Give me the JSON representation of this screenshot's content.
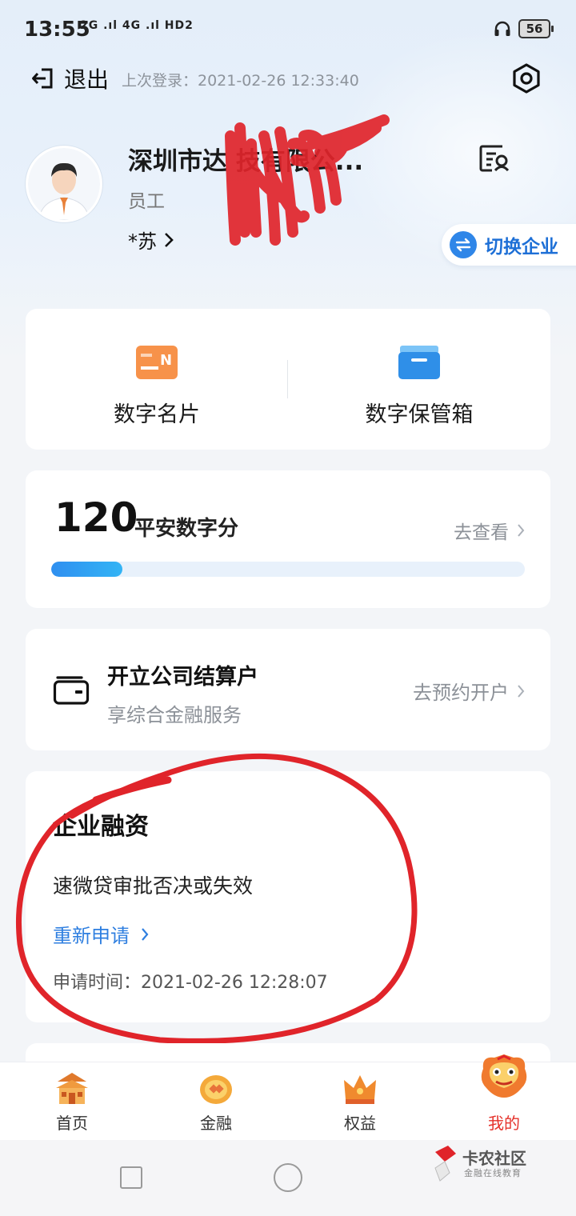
{
  "status_bar": {
    "time": "13:55",
    "network": "2G .ıl 4G .ıl HD2",
    "battery": "56"
  },
  "header": {
    "logout_label": "退出",
    "last_login": "上次登录：2021-02-26 12:33:40"
  },
  "profile": {
    "company": "深圳市达      技有限公...",
    "role": "员工",
    "user_name": "*苏",
    "switch_label": "切换企业"
  },
  "quick_actions": [
    {
      "label": "数字名片",
      "icon": "business-card-icon"
    },
    {
      "label": "数字保管箱",
      "icon": "safe-box-icon"
    }
  ],
  "score": {
    "value": "120",
    "label": "平安数字分",
    "link": "去查看",
    "progress": 0.15
  },
  "account": {
    "title": "开立公司结算户",
    "subtitle": "享综合金融服务",
    "link": "去预约开户"
  },
  "finance": {
    "title": "企业融资",
    "status": "速微贷审批否决或失效",
    "reapply": "重新申请",
    "apply_time": "申请时间：2021-02-26 12:28:07"
  },
  "tabs": [
    {
      "label": "首页",
      "icon": "home-temple-icon"
    },
    {
      "label": "金融",
      "icon": "coin-icon"
    },
    {
      "label": "权益",
      "icon": "crown-icon"
    },
    {
      "label": "我的",
      "icon": "lion-mask-icon",
      "active": true
    }
  ],
  "watermark": {
    "brand": "卡农社区",
    "tagline": "金融在线教育"
  },
  "colors": {
    "accent_blue": "#2f7fe0",
    "active_tab_red": "#e5312a",
    "annotation_red": "#e0242a"
  }
}
